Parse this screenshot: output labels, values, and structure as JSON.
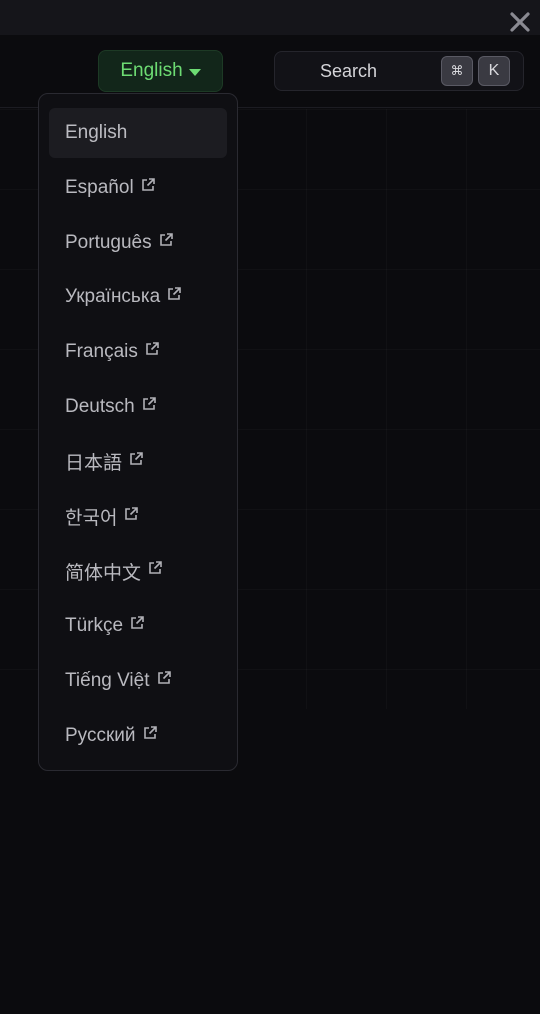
{
  "header": {
    "language_button": "English",
    "search": {
      "label": "Search",
      "shortcut_modifier": "⌘",
      "shortcut_key": "K"
    }
  },
  "language_menu": {
    "items": [
      {
        "label": "English",
        "external": false,
        "active": true
      },
      {
        "label": "Español",
        "external": true
      },
      {
        "label": "Português",
        "external": true
      },
      {
        "label": "Українська",
        "external": true
      },
      {
        "label": "Français",
        "external": true
      },
      {
        "label": "Deutsch",
        "external": true
      },
      {
        "label": "日本語",
        "external": true
      },
      {
        "label": "한국어",
        "external": true
      },
      {
        "label": "简体中文",
        "external": true
      },
      {
        "label": "Türkçe",
        "external": true
      },
      {
        "label": "Tiếng Việt",
        "external": true
      },
      {
        "label": "Русский",
        "external": true
      }
    ]
  },
  "colors": {
    "accent_green": "#6ddc73",
    "background": "#0b0b0e"
  },
  "icons": {
    "close": "close-icon",
    "external": "external-link-icon",
    "caret": "caret-down-icon"
  }
}
